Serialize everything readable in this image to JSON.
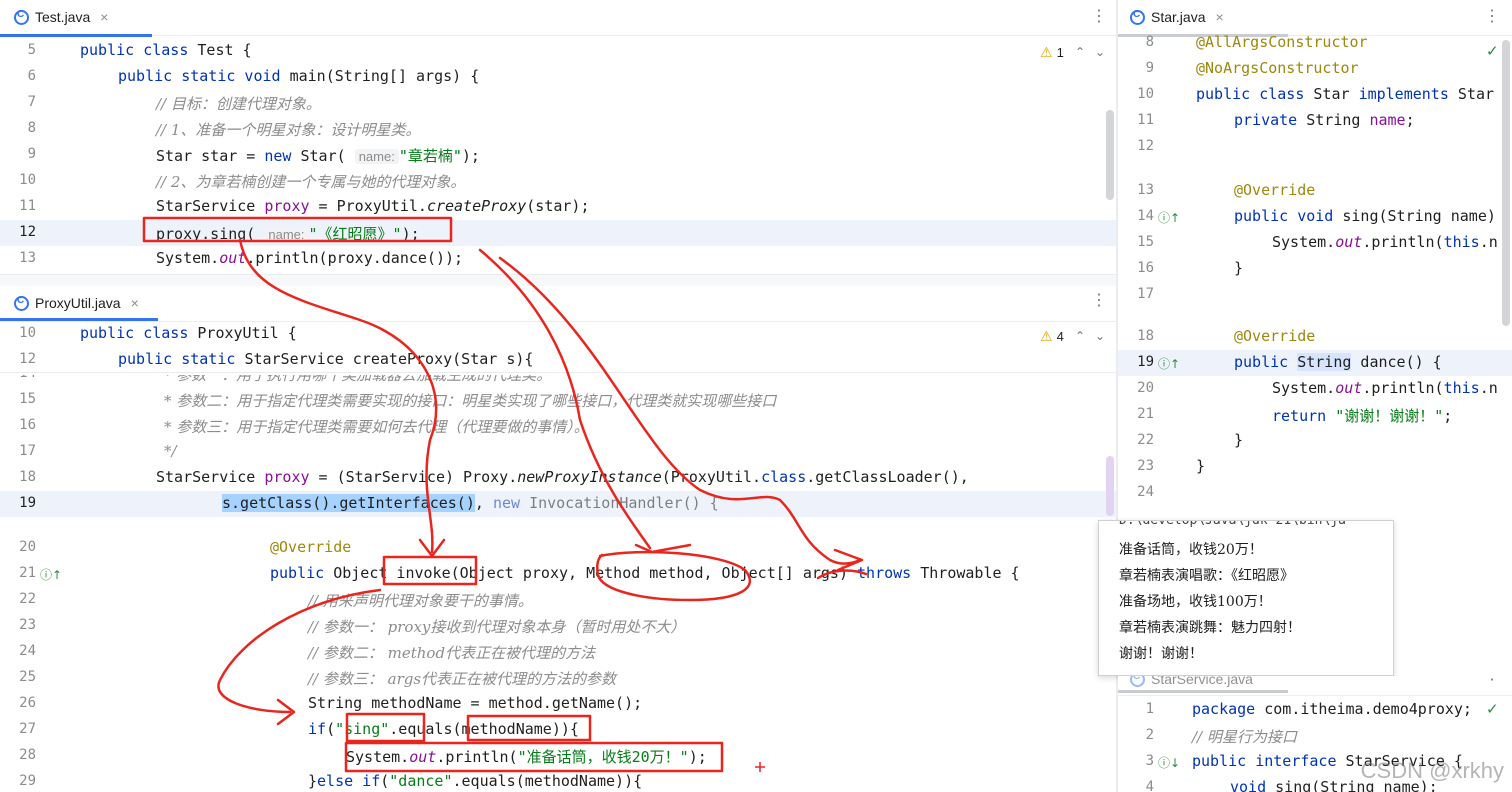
{
  "test_tab": {
    "title": "Test.java",
    "warnings": "1"
  },
  "proxyutil_tab": {
    "title": "ProxyUtil.java",
    "warnings": "4"
  },
  "star_tab": {
    "title": "Star.java"
  },
  "starservice_tab": {
    "title": "StarService.java"
  },
  "watermark": "CSDN @xrkhy",
  "test_code": {
    "l5": {
      "num": "5",
      "a": "public class ",
      "b": "Test {"
    },
    "l6": {
      "num": "6",
      "a": "public static void ",
      "b": "main(String[] args) {"
    },
    "l7": {
      "num": "7",
      "text": "// 目标：创建代理对象。"
    },
    "l8": {
      "num": "8",
      "text": "// 1、准备一个明星对象：设计明星类。"
    },
    "l9": {
      "num": "9",
      "a": "Star star = ",
      "kw": "new ",
      "b": "Star(",
      "hint": "name:",
      "str": "\"章若楠\"",
      "c": ");"
    },
    "l10": {
      "num": "10",
      "text": "// 2、为章若楠创建一个专属与她的代理对象。"
    },
    "l11": {
      "num": "11",
      "a": "StarService ",
      "var": "proxy",
      "b": " = ProxyUtil.",
      "it": "createProxy",
      "c": "(star);"
    },
    "l12": {
      "num": "12",
      "a": "proxy.sing(",
      "hint": "name:",
      "str": "\"《红昭愿》\"",
      "c": ");"
    },
    "l13": {
      "num": "13",
      "a": "System.",
      "fld": "out",
      "b": ".println(proxy.dance());"
    }
  },
  "proxy_code": {
    "l10": {
      "num": "10",
      "a": "public class ",
      "b": "ProxyUtil {"
    },
    "l12": {
      "num": "12",
      "a": "public static ",
      "b": "StarService createProxy(Star s){"
    },
    "l14": {
      "num": "14",
      "text": "* 参数一：用于执行用哪个类加载器去加载生成的代理类。"
    },
    "l15": {
      "num": "15",
      "text": "* 参数二：用于指定代理类需要实现的接口：明星类实现了哪些接口，代理类就实现哪些接口"
    },
    "l16": {
      "num": "16",
      "text": "* 参数三：用于指定代理类需要如何去代理（代理要做的事情）。"
    },
    "l17": {
      "num": "17",
      "text": "*/"
    },
    "l18": {
      "num": "18",
      "a": "StarService ",
      "var": "proxy",
      "b": " = (StarService) Proxy.",
      "it": "newProxyInstance",
      "c": "(ProxyUtil.",
      "kw": "class",
      "d": ".getClassLoader(),"
    },
    "l19": {
      "num": "19",
      "sel": "s.getClass().getInterfaces()",
      "b": ", ",
      "kw": "new ",
      "c": "InvocationHandler() {"
    },
    "l20": {
      "num": "20",
      "ann": "@Override"
    },
    "l21": {
      "num": "21",
      "kw": "public ",
      "a": "Object invoke(Object proxy, Method method, Object[] args) ",
      "kw2": "throws ",
      "b": "Throwable {"
    },
    "l22": {
      "num": "22",
      "text": "// 用来声明代理对象要干的事情。"
    },
    "l23": {
      "num": "23",
      "text": "// 参数一： proxy接收到代理对象本身（暂时用处不大）"
    },
    "l24": {
      "num": "24",
      "text": "// 参数二： method代表正在被代理的方法"
    },
    "l25": {
      "num": "25",
      "text": "// 参数三： args代表正在被代理的方法的参数"
    },
    "l26": {
      "num": "26",
      "a": "String methodName = method.getName();"
    },
    "l27": {
      "num": "27",
      "kw": "if",
      "a": "(",
      "str": "\"sing\"",
      "b": ".equals(methodName)){"
    },
    "l28": {
      "num": "28",
      "a": "System.",
      "fld": "out",
      "b": ".println(",
      "str": "\"准备话筒，收钱20万！\"",
      "c": ");"
    },
    "l29": {
      "num": "29",
      "a": "}",
      "kw": "else if",
      "b": "(",
      "str": "\"dance\"",
      "c": ".equals(methodName)){"
    }
  },
  "star_code": {
    "l8": {
      "num": "8",
      "ann": "@AllArgsConstructor"
    },
    "l9": {
      "num": "9",
      "ann": "@NoArgsConstructor"
    },
    "l10": {
      "num": "10",
      "kw": "public class ",
      "a": "Star ",
      "kw2": "implements ",
      "b": "Star"
    },
    "l11": {
      "num": "11",
      "kw": "private ",
      "a": "String ",
      "fld": "name",
      "b": ";"
    },
    "l12": {
      "num": "12"
    },
    "l13": {
      "num": "13",
      "ann": "@Override"
    },
    "l14": {
      "num": "14",
      "kw": "public void ",
      "a": "sing(String name)"
    },
    "l15": {
      "num": "15",
      "a": "System.",
      "fld": "out",
      "b": ".println(",
      "kw": "this",
      "c": ".n"
    },
    "l16": {
      "num": "16",
      "a": "}"
    },
    "l17": {
      "num": "17"
    },
    "l18": {
      "num": "18",
      "ann": "@Override"
    },
    "l19": {
      "num": "19",
      "kw": "public ",
      "hw": "String",
      "a": " dance() {"
    },
    "l20": {
      "num": "20",
      "a": "System.",
      "fld": "out",
      "b": ".println(",
      "kw": "this",
      "c": ".n"
    },
    "l21": {
      "num": "21",
      "kw": "return ",
      "str": "\"谢谢！谢谢！\"",
      "a": ";"
    },
    "l22": {
      "num": "22",
      "a": "}"
    },
    "l23": {
      "num": "23",
      "a": "}"
    },
    "l24": {
      "num": "24"
    }
  },
  "starservice_code": {
    "l1": {
      "num": "1",
      "kw": "package ",
      "a": "com.itheima.demo4proxy;"
    },
    "l2": {
      "num": "2",
      "text": "// 明星行为接口"
    },
    "l3": {
      "num": "3",
      "kw": "public interface ",
      "a": "StarService {"
    },
    "l4": {
      "num": "4",
      "kw": "void ",
      "a": "sing(String name);"
    }
  },
  "console": {
    "header": "D:\\develop\\Java\\jdk-21\\bin\\ja",
    "lines": [
      "准备话筒，收钱20万！",
      "章若楠表演唱歌：《红昭愿》",
      "准备场地，收钱100万！",
      "章若楠表演跳舞：魅力四射！",
      "谢谢！谢谢！"
    ]
  },
  "colors": {
    "annotation_red": "#e8261d",
    "accent": "#3574f0",
    "keyword": "#0033b3",
    "string": "#067d17",
    "comment": "#8c8c8c"
  }
}
